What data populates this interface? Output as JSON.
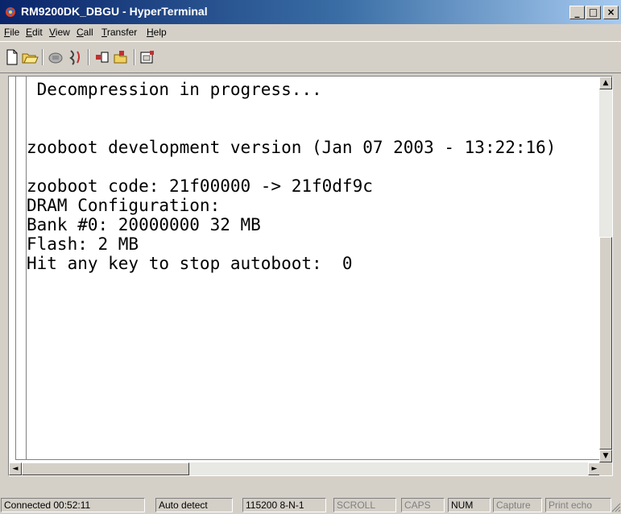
{
  "window": {
    "title": "RM9200DK_DBGU - HyperTerminal",
    "icon": "hyperterminal-icon",
    "controls": {
      "minimize": "_",
      "maximize": "□",
      "close": "×"
    }
  },
  "menu": [
    {
      "mnemonic": "F",
      "rest": "ile"
    },
    {
      "mnemonic": "E",
      "rest": "dit"
    },
    {
      "mnemonic": "V",
      "rest": "iew"
    },
    {
      "mnemonic": "C",
      "rest": "all"
    },
    {
      "mnemonic": "T",
      "rest": "ransfer"
    },
    {
      "mnemonic": "H",
      "rest": "elp"
    }
  ],
  "toolbar": [
    {
      "icon": "new-document-icon"
    },
    {
      "icon": "open-folder-icon"
    },
    {
      "icon": "dial-phone-icon"
    },
    {
      "icon": "disconnect-phone-icon"
    },
    {
      "icon": "send-icon"
    },
    {
      "icon": "receive-icon"
    },
    {
      "icon": "properties-icon"
    }
  ],
  "terminal": {
    "text": " Decompression in progress...\n\n\nzooboot development version (Jan 07 2003 - 13:22:16)\n\nzooboot code: 21f00000 -> 21f0df9c\nDRAM Configuration:\nBank #0: 20000000 32 MB\nFlash: 2 MB\nHit any key to stop autoboot:  0"
  },
  "scrollbars": {
    "up": "▲",
    "down": "▼",
    "left": "◄",
    "right": "►"
  },
  "status": {
    "connected": "Connected 00:52:11",
    "detect": "Auto detect",
    "settings": "115200 8-N-1",
    "scroll": "SCROLL",
    "caps": "CAPS",
    "num": "NUM",
    "capture": "Capture",
    "print": "Print echo"
  },
  "colors": {
    "titlebar_start": "#0a246a",
    "titlebar_end": "#a6caf0",
    "face": "#d4d0c8",
    "terminal_bg": "#ffffff",
    "terminal_fg": "#000000"
  }
}
